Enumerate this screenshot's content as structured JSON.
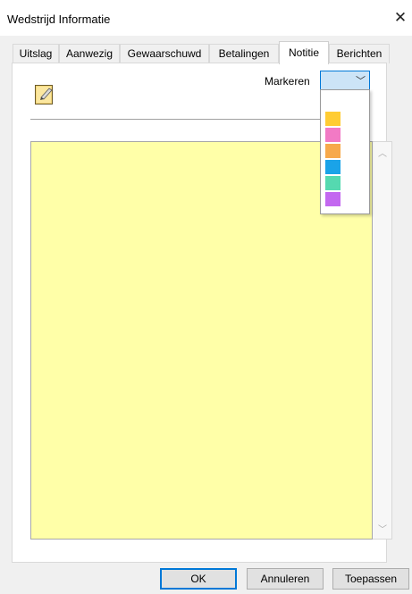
{
  "window": {
    "title": "Wedstrijd Informatie"
  },
  "tabs": [
    {
      "label": "Uitslag"
    },
    {
      "label": "Aanwezig"
    },
    {
      "label": "Gewaarschuwd"
    },
    {
      "label": "Betalingen"
    },
    {
      "label": "Notitie"
    },
    {
      "label": "Berichten"
    }
  ],
  "active_tab": "Notitie",
  "note": {
    "marker_label": "Markeren",
    "marker_colors": [
      "#ffcc33",
      "#f27ac5",
      "#f7a94b",
      "#1aa3e8",
      "#55d9b0",
      "#c368f0"
    ],
    "note_background": "#ffffa8",
    "text": ""
  },
  "buttons": {
    "ok": "OK",
    "cancel": "Annuleren",
    "apply": "Toepassen"
  },
  "icons": {
    "close": "close-icon",
    "note": "note-pad-icon",
    "combo": "chevron-down-icon"
  }
}
